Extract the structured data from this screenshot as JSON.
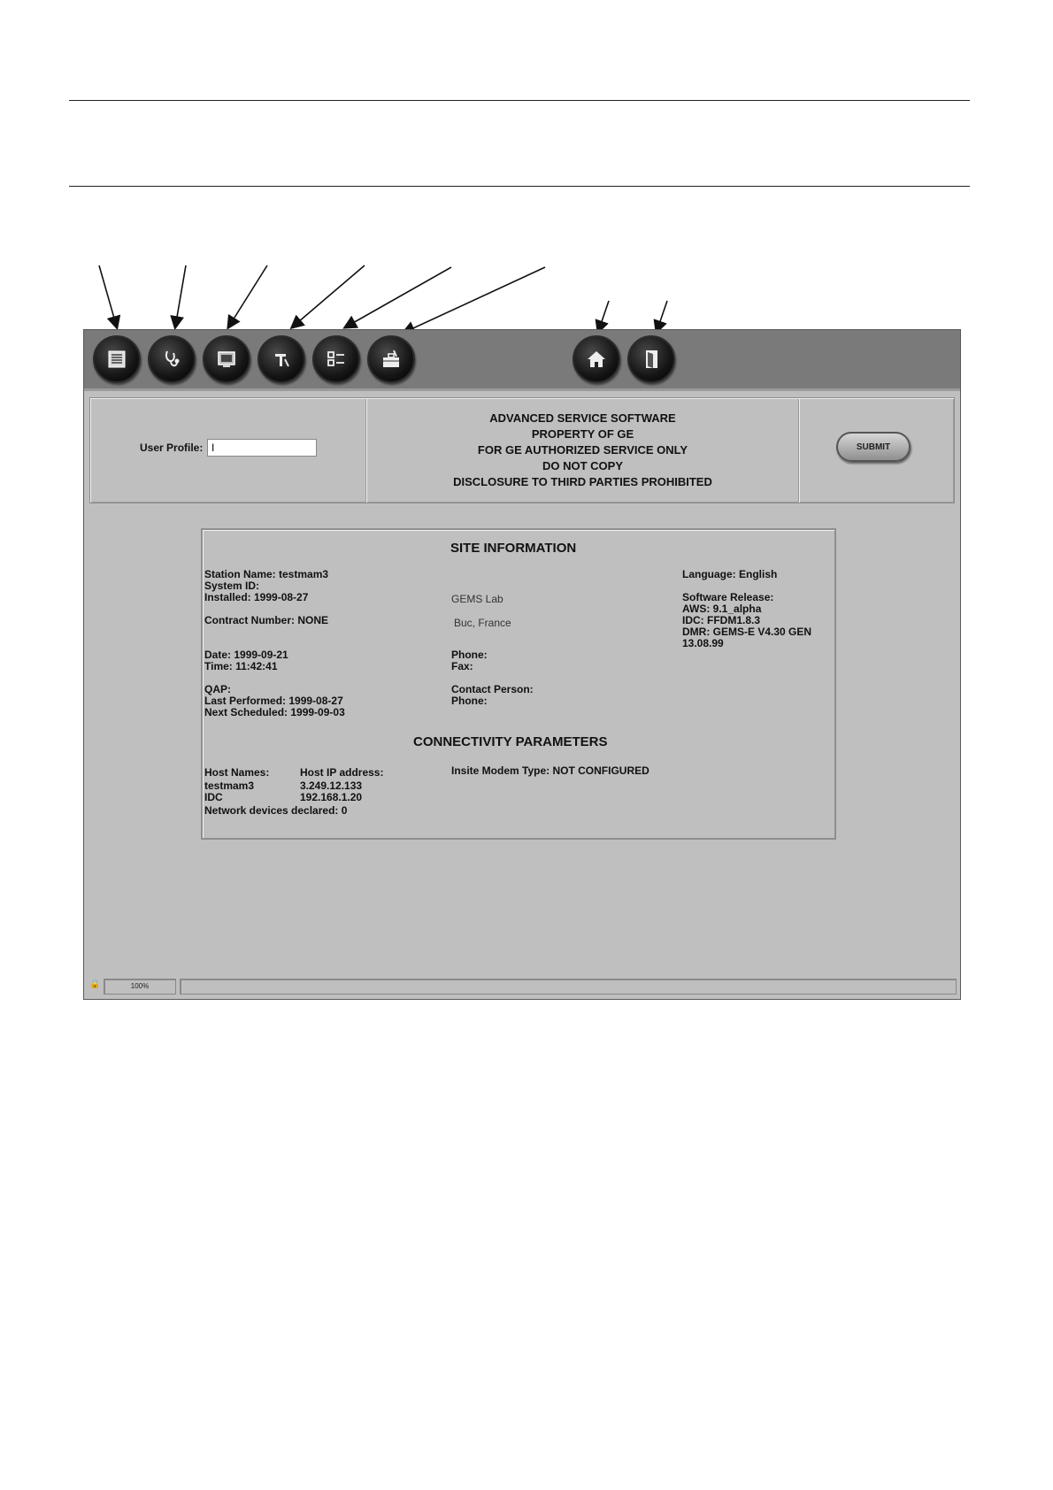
{
  "toolbar": {
    "buttons": [
      {
        "name": "list-icon"
      },
      {
        "name": "stethoscope-icon"
      },
      {
        "name": "monitor-icon"
      },
      {
        "name": "tools-icon"
      },
      {
        "name": "checklist-icon"
      },
      {
        "name": "toolbox-icon"
      },
      {
        "name": "home-icon"
      },
      {
        "name": "exit-door-icon"
      }
    ]
  },
  "header": {
    "user_profile_label": "User Profile:",
    "user_profile_value": "I",
    "notice_lines": [
      "ADVANCED SERVICE SOFTWARE",
      "PROPERTY OF GE",
      "FOR GE AUTHORIZED SERVICE ONLY",
      "DO NOT COPY",
      "DISCLOSURE TO THIRD PARTIES PROHIBITED"
    ],
    "submit_label": "SUBMIT"
  },
  "site": {
    "title": "SITE INFORMATION",
    "station_name": "Station Name: testmam3",
    "system_id": "System ID:",
    "installed": "Installed: 1999-08-27",
    "contract": "Contract Number: NONE",
    "date": "Date: 1999-09-21",
    "time": "Time: 11:42:41",
    "qap": "QAP:",
    "last_performed": "Last Performed: 1999-08-27",
    "next_scheduled": "Next Scheduled: 1999-09-03",
    "site_name": "GEMS Lab",
    "site_location": "Buc, France",
    "phone": "Phone:",
    "fax": "Fax:",
    "contact_person": "Contact Person:",
    "contact_phone": "Phone:",
    "language": "Language: English",
    "software_release": "Software Release:",
    "aws": "AWS: 9.1_alpha",
    "idc": "IDC: FFDM1.8.3",
    "dmr": "DMR: GEMS-E V4.30 GEN",
    "dmr_date": "13.08.99"
  },
  "connectivity": {
    "title": "CONNECTIVITY PARAMETERS",
    "host_names_header": "Host Names:",
    "host_ip_header": "Host IP address:",
    "hosts": [
      {
        "name": "testmam3",
        "ip": "3.249.12.133"
      },
      {
        "name": "IDC",
        "ip": "192.168.1.20"
      }
    ],
    "network_devices": "Network devices declared:  0",
    "modem": "Insite Modem Type: NOT CONFIGURED"
  },
  "statusbar": {
    "zoom": "100%"
  }
}
